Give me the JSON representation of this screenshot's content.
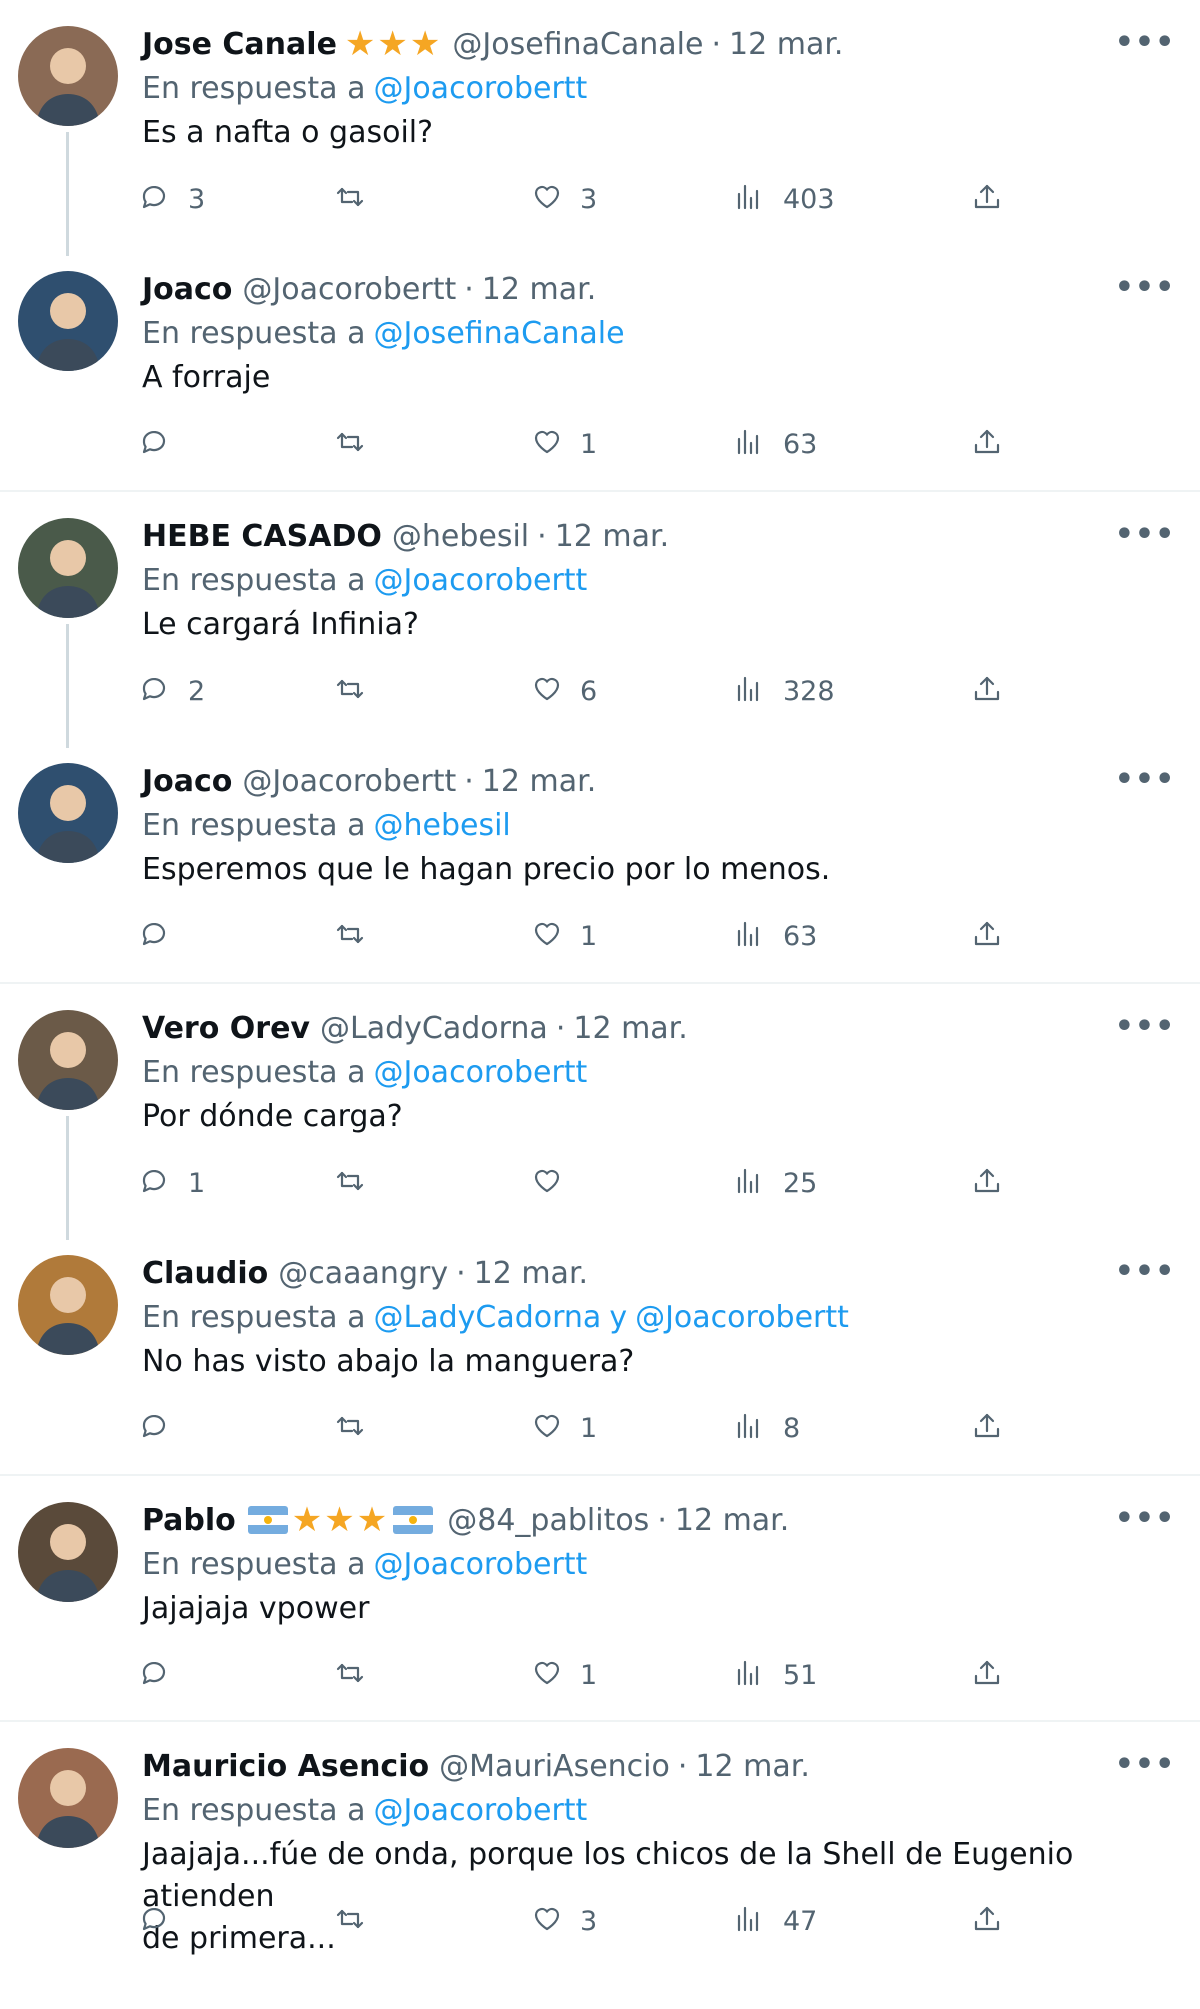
{
  "reply_prefix": "En respuesta a",
  "tweets": [
    {
      "name": "Jose Canale",
      "handle": "@JosefinaCanale",
      "time": "12 mar.",
      "badges": "stars3",
      "reply_to": [
        "@Joacorobertt"
      ],
      "text": [
        "Es a nafta o gasoil?"
      ],
      "replies": "3",
      "retweets": "",
      "likes": "3",
      "views": "403",
      "avatar_color": "#8a6a55",
      "thread_line": true
    },
    {
      "name": "Joaco",
      "handle": "@Joacorobertt",
      "time": "12 mar.",
      "badges": "",
      "reply_to": [
        "@JosefinaCanale"
      ],
      "text": [
        "A forraje"
      ],
      "replies": "",
      "retweets": "",
      "likes": "1",
      "views": "63",
      "avatar_color": "#2f4f6f",
      "thread_line": false
    },
    {
      "name": "HEBE CASADO",
      "handle": "@hebesil",
      "time": "12 mar.",
      "badges": "",
      "reply_to": [
        "@Joacorobertt"
      ],
      "text": [
        "Le cargará Infinia?"
      ],
      "replies": "2",
      "retweets": "",
      "likes": "6",
      "views": "328",
      "avatar_color": "#4a5a4a",
      "thread_line": true
    },
    {
      "name": "Joaco",
      "handle": "@Joacorobertt",
      "time": "12 mar.",
      "badges": "",
      "reply_to": [
        "@hebesil"
      ],
      "text": [
        "Esperemos que le hagan precio por lo menos."
      ],
      "replies": "",
      "retweets": "",
      "likes": "1",
      "views": "63",
      "avatar_color": "#2f4f6f",
      "thread_line": false
    },
    {
      "name": "Vero Orev",
      "handle": "@LadyCadorna",
      "time": "12 mar.",
      "badges": "",
      "reply_to": [
        "@Joacorobertt"
      ],
      "text": [
        "Por dónde carga?"
      ],
      "replies": "1",
      "retweets": "",
      "likes": "",
      "views": "25",
      "avatar_color": "#6b5a48",
      "thread_line": true
    },
    {
      "name": "Claudio",
      "handle": "@caaangry",
      "time": "12 mar.",
      "badges": "",
      "reply_to": [
        "@LadyCadorna",
        "@Joacorobertt"
      ],
      "reply_join": "y",
      "text": [
        "No has visto abajo la manguera?"
      ],
      "replies": "",
      "retweets": "",
      "likes": "1",
      "views": "8",
      "avatar_color": "#b07a3a",
      "thread_line": false
    },
    {
      "name": "Pablo",
      "handle": "@84_pablitos",
      "time": "12 mar.",
      "badges": "flag-stars3-flag",
      "reply_to": [
        "@Joacorobertt"
      ],
      "text": [
        "Jajajaja vpower"
      ],
      "replies": "",
      "retweets": "",
      "likes": "1",
      "views": "51",
      "avatar_color": "#5a4a3a",
      "thread_line": false
    },
    {
      "name": "Mauricio Asencio",
      "handle": "@MauriAsencio",
      "time": "12 mar.",
      "badges": "",
      "reply_to": [
        "@Joacorobertt"
      ],
      "text": [
        "Jaajaja...fúe de onda, porque los chicos de la Shell de Eugenio atienden",
        "de primera..."
      ],
      "replies": "",
      "retweets": "",
      "likes": "3",
      "views": "47",
      "avatar_color": "#9a6a50",
      "thread_line": false
    }
  ]
}
